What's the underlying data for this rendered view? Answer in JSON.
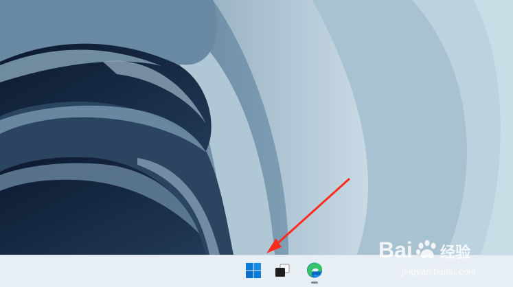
{
  "taskbar": {
    "icons": [
      {
        "name": "windows-start-icon",
        "running": false
      },
      {
        "name": "task-view-icon",
        "running": false
      },
      {
        "name": "edge-browser-icon",
        "running": true
      }
    ]
  },
  "annotation": {
    "arrow_color": "#ff2b1f"
  },
  "watermark": {
    "brand": "Baidu 经验",
    "url": "jingyan.baidu.com"
  },
  "colors": {
    "taskbar_bg": "#e7eef4",
    "windows_blue": "#0a7ad7",
    "edge_green": "#34c46a",
    "edge_blue": "#0b6bc8"
  }
}
